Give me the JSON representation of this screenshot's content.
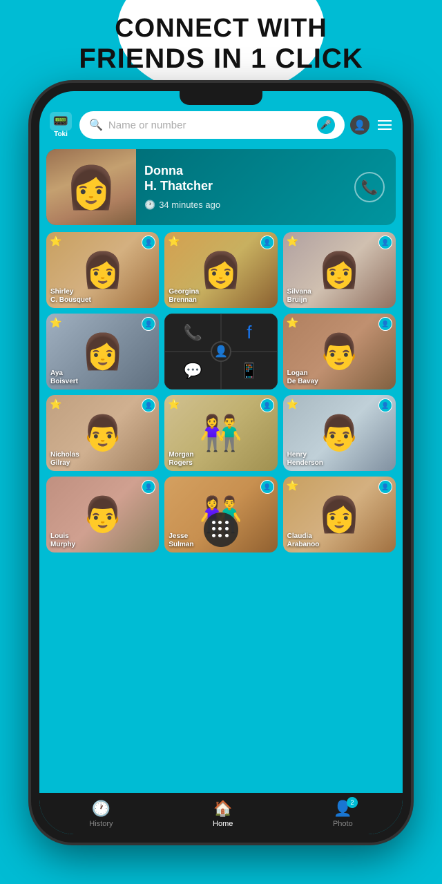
{
  "header": {
    "line1": "CONNECT WITH",
    "line2": "FRIENDS IN 1 CLICK"
  },
  "app": {
    "logo_label": "Toki",
    "logo_icon": "📟",
    "search_placeholder": "Name or number"
  },
  "featured_contact": {
    "name_line1": "Donna",
    "name_line2": "H. Thatcher",
    "time_ago": "34 minutes ago"
  },
  "contacts": [
    {
      "name": "Shirley\nC. Bousquet",
      "starred": true,
      "photo_class": "photo-1"
    },
    {
      "name": "Georgina\nBrennan",
      "starred": true,
      "photo_class": "photo-2"
    },
    {
      "name": "Silvana\nBruijn",
      "starred": true,
      "photo_class": "photo-3"
    },
    {
      "name": "Aya\nBoisvert",
      "starred": true,
      "photo_class": "photo-4",
      "type": "photo"
    },
    {
      "name": "",
      "starred": false,
      "photo_class": "",
      "type": "social"
    },
    {
      "name": "Logan\nDe Bavay",
      "starred": true,
      "photo_class": "photo-5"
    },
    {
      "name": "Nicholas\nGilray",
      "starred": true,
      "photo_class": "photo-6"
    },
    {
      "name": "Morgan\nRogers",
      "starred": true,
      "photo_class": "photo-7"
    },
    {
      "name": "Henry\nHenderson",
      "starred": true,
      "photo_class": "photo-8"
    },
    {
      "name": "Louis\nMurphy",
      "starred": false,
      "photo_class": "photo-9",
      "type": "photo"
    },
    {
      "name": "Jesse\nSulman",
      "starred": false,
      "photo_class": "photo-10",
      "type": "dialpad"
    },
    {
      "name": "Claudia\nArabanoo",
      "starred": true,
      "photo_class": "photo-1"
    }
  ],
  "bottom_nav": [
    {
      "label": "History",
      "icon": "🕐",
      "active": false,
      "badge": null
    },
    {
      "label": "Home",
      "icon": "🏠",
      "active": true,
      "badge": null
    },
    {
      "label": "Photo",
      "icon": "👤",
      "active": false,
      "badge": "2"
    }
  ]
}
